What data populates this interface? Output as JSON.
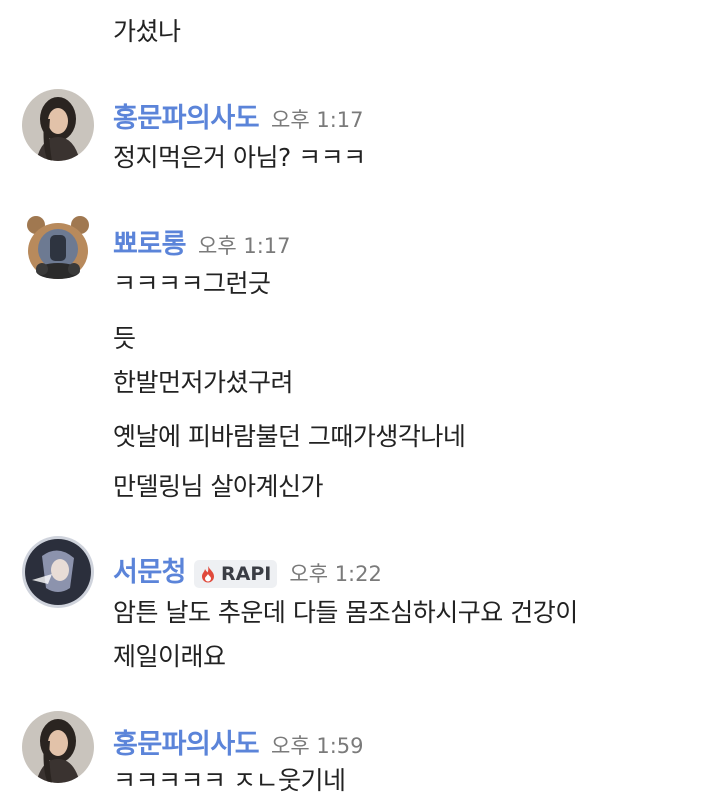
{
  "messages": [
    {
      "lines": [
        "가셨나"
      ]
    },
    {
      "author": "홍문파의사도",
      "time": "오후 1:17",
      "avatar_icon": "woman-portrait-avatar",
      "lines": [
        "정지먹은거 아님? ㅋㅋㅋ"
      ]
    },
    {
      "author": "뾰로롱",
      "time": "오후 1:17",
      "avatar_icon": "bear-plush-avatar",
      "lines": [
        "ㅋㅋㅋㅋ그런긋",
        "듯",
        "한발먼저가셨구려",
        "옛날에 피바람불던 그때가생각나네",
        "만델링님 살아계신가"
      ]
    },
    {
      "author": "서문청",
      "time": "오후 1:22",
      "avatar_icon": "anime-character-avatar",
      "badge": {
        "icon": "flame-icon",
        "label": "RAPI",
        "color": "#e04a3c"
      },
      "lines": [
        "암튼 날도 추운데 다들 몸조심하시구요 건강이",
        "제일이래요"
      ]
    },
    {
      "author": "홍문파의사도",
      "time": "오후 1:59",
      "avatar_icon": "woman-portrait-avatar",
      "lines": [
        "ㅋㅋㅋㅋㅋ ㅈㄴ웃기네"
      ]
    }
  ],
  "colors": {
    "author_name": "#5b84d9",
    "timestamp": "#7a7a7a",
    "message_text": "#222222",
    "badge_bg": "#eef0f3"
  }
}
